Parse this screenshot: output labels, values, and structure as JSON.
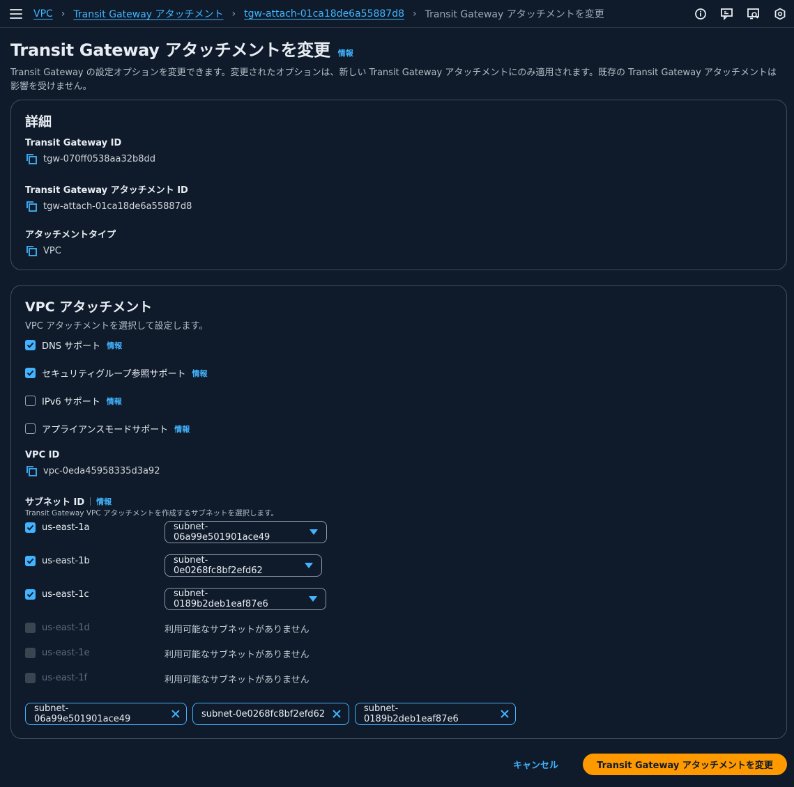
{
  "breadcrumb": {
    "items": [
      "VPC",
      "Transit Gateway アタッチメント",
      "tgw-attach-01ca18de6a55887d8"
    ],
    "current": "Transit Gateway アタッチメントを変更"
  },
  "header": {
    "title": "Transit Gateway アタッチメントを変更",
    "info": "情報",
    "description": "Transit Gateway の設定オプションを変更できます。変更されたオプションは、新しい Transit Gateway アタッチメントにのみ適用されます。既存の Transit Gateway アタッチメントは影響を受けません。"
  },
  "details": {
    "title": "詳細",
    "fields": [
      {
        "label": "Transit Gateway ID",
        "value": "tgw-070ff0538aa32b8dd"
      },
      {
        "label": "Transit Gateway アタッチメント ID",
        "value": "tgw-attach-01ca18de6a55887d8"
      },
      {
        "label": "アタッチメントタイプ",
        "value": "VPC"
      }
    ]
  },
  "vpc_attachment": {
    "title": "VPC アタッチメント",
    "description": "VPC アタッチメントを選択して設定します。",
    "options": [
      {
        "label": "DNS サポート",
        "checked": true,
        "info": "情報"
      },
      {
        "label": "セキュリティグループ参照サポート",
        "checked": true,
        "info": "情報"
      },
      {
        "label": "IPv6 サポート",
        "checked": false,
        "info": "情報"
      },
      {
        "label": "アプライアンスモードサポート",
        "checked": false,
        "info": "情報"
      }
    ],
    "vpc_id_label": "VPC ID",
    "vpc_id": "vpc-0eda45958335d3a92",
    "subnet_label": "サブネット ID",
    "subnet_info": "情報",
    "subnet_desc": "Transit Gateway VPC アタッチメントを作成するサブネットを選択します。",
    "azs": [
      {
        "az": "us-east-1a",
        "checked": true,
        "subnet": "subnet-06a99e501901ace49"
      },
      {
        "az": "us-east-1b",
        "checked": true,
        "subnet": "subnet-0e0268fc8bf2efd62"
      },
      {
        "az": "us-east-1c",
        "checked": true,
        "subnet": "subnet-0189b2deb1eaf87e6"
      },
      {
        "az": "us-east-1d",
        "checked": false,
        "subnet": "利用可能なサブネットがありません"
      },
      {
        "az": "us-east-1e",
        "checked": false,
        "subnet": "利用可能なサブネットがありません"
      },
      {
        "az": "us-east-1f",
        "checked": false,
        "subnet": "利用可能なサブネットがありません"
      }
    ],
    "tokens": [
      "subnet-06a99e501901ace49",
      "subnet-0e0268fc8bf2efd62",
      "subnet-0189b2deb1eaf87e6"
    ]
  },
  "footer": {
    "cancel": "キャンセル",
    "submit": "Transit Gateway アタッチメントを変更"
  },
  "colors": {
    "accent": "#42b4ff",
    "primary": "#ff9900",
    "background": "#0f1b2a"
  }
}
